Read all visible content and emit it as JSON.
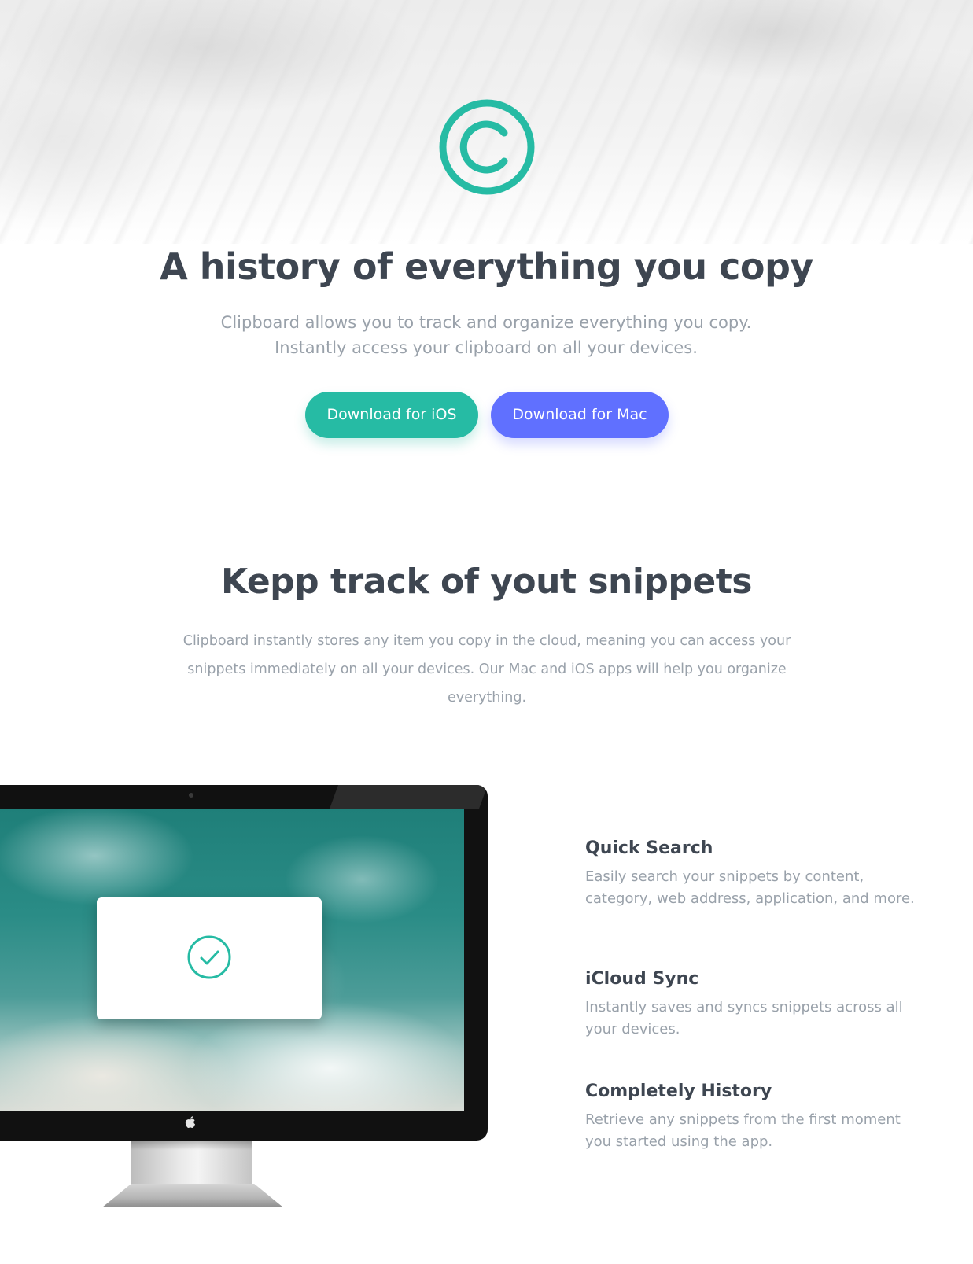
{
  "colors": {
    "accent_teal": "#26bba4",
    "accent_indigo": "#6070ff",
    "heading": "#3e4651",
    "body_text": "#99a1aa"
  },
  "hero": {
    "logo_icon": "copyright-icon",
    "title": "A history of everything you copy",
    "subtitle_line1": "Clipboard allows you to track and organize everything you copy.",
    "subtitle_line2": "Instantly access your clipboard on all your devices.",
    "download_ios_label": "Download for iOS",
    "download_mac_label": "Download for Mac"
  },
  "snippets": {
    "title": "Kepp track of yout snippets",
    "body": "Clipboard instantly stores any item you copy in the cloud, meaning you can access your snippets immediately on all your devices. Our Mac and iOS apps will help you organize everything."
  },
  "monitor": {
    "dialog_icon": "check-circle-icon",
    "logo_icon": "apple-icon"
  },
  "features": [
    {
      "title": "Quick Search",
      "description": "Easily search your snippets by content, category, web address, application, and more."
    },
    {
      "title": "iCloud Sync",
      "description": "Instantly saves and syncs snippets across all your devices."
    },
    {
      "title": "Completely History",
      "description": "Retrieve any snippets from the first moment you started using the app."
    }
  ]
}
